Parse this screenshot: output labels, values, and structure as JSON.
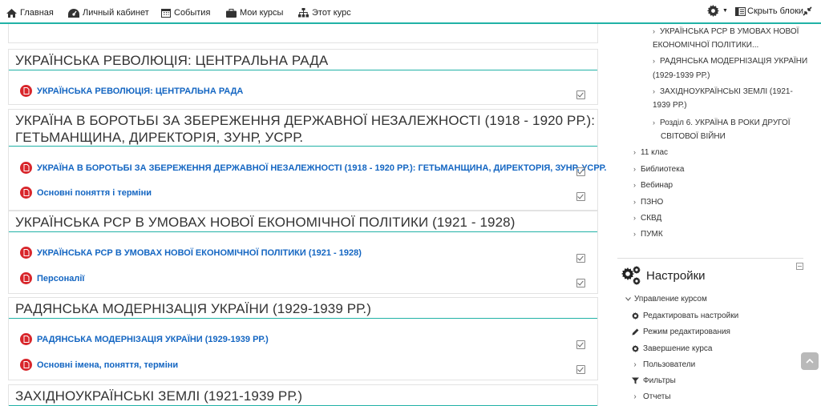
{
  "navbar": {
    "items": [
      {
        "label": "Главная",
        "icon": "home-icon"
      },
      {
        "label": "Личный кабинет",
        "icon": "dashboard-icon"
      },
      {
        "label": "События",
        "icon": "calendar-icon"
      },
      {
        "label": "Мои курсы",
        "icon": "briefcase-icon"
      },
      {
        "label": "Этот курс",
        "icon": "sitemap-icon"
      }
    ],
    "hide_blocks_label": "Скрыть блоки",
    "accent": "#21b2a6"
  },
  "sections": [
    {
      "title": "УКРАЇНСЬКА РЕВОЛЮЦІЯ: ЦЕНТРАЛЬНА РАДА",
      "activities": [
        "УКРАЇНСЬКА РЕВОЛЮЦІЯ: ЦЕНТРАЛЬНА РАДА"
      ]
    },
    {
      "title_line1": "УКРАЇНА В БОРОТЬБІ ЗА ЗБЕРЕЖЕННЯ ДЕРЖАВНОЇ НЕЗАЛЕЖНОСТІ (1918 - 1920 РР.):",
      "title_line2": "ГЕТЬМАНЩИНА, ДИРЕКТОРІЯ, ЗУНР, УСРР.",
      "activities": [
        "УКРАЇНА В БОРОТЬБІ ЗА ЗБЕРЕЖЕННЯ ДЕРЖАВНОЇ НЕЗАЛЕЖНОСТІ (1918 - 1920 РР.): ГЕТЬМАНЩИНА, ДИРЕКТОРІЯ, ЗУНР, УСРР.",
        "Основні поняття і терміни"
      ]
    },
    {
      "title": "УКРАЇНСЬКА РСР В УМОВАХ НОВОЇ ЕКОНОМІЧНОЇ ПОЛІТИКИ (1921 - 1928)",
      "activities": [
        "УКРАЇНСЬКА РСР В УМОВАХ НОВОЇ ЕКОНОМІЧНОЇ ПОЛІТИКИ (1921 - 1928)",
        "Персоналії"
      ]
    },
    {
      "title": "РАДЯНСЬКА МОДЕРНІЗАЦІЯ УКРАЇНИ (1929-1939 РР.)",
      "activities": [
        "РАДЯНСЬКА МОДЕРНІЗАЦІЯ УКРАЇНИ (1929-1939 РР.)",
        "Основні імена, поняття, терміни"
      ]
    },
    {
      "title": "ЗАХІДНОУКРАЇНСЬКІ ЗЕМЛІ (1921-1939 РР.)",
      "activities": []
    }
  ],
  "nav_tree": {
    "items": [
      {
        "line1": "УКРАЇНСЬКА РСР В УМОВАХ НОВОЇ",
        "line2": "ЕКОНОМІЧНОЇ ПОЛІТИКИ..."
      },
      {
        "line1": "РАДЯНСЬКА МОДЕРНІЗАЦІЯ УКРАЇНИ",
        "line2": "(1929-1939 РР.)"
      },
      {
        "line1": "ЗАХІДНОУКРАЇНСЬКІ ЗЕМЛІ (1921-",
        "line2": "1939 РР.)"
      },
      {
        "line1": "Розділ 6. УКРАЇНА В РОКИ ДРУГОЇ",
        "line2": "СВІТОВОЇ ВІЙНИ"
      }
    ],
    "top_items": [
      "11 клас",
      "Библиотека",
      "Вебинар",
      "ПЗНО",
      "СКВД",
      "ПУМК"
    ]
  },
  "settings": {
    "title": "Настройки",
    "course_admin": "Управление курсом",
    "items": [
      {
        "label": "Редактировать настройки",
        "icon": "gear-icon"
      },
      {
        "label": "Режим редактирования",
        "icon": "pencil-icon"
      },
      {
        "label": "Завершение курса",
        "icon": "gear-icon"
      },
      {
        "label": "Пользователи",
        "icon": "chevron-right-icon"
      },
      {
        "label": "Фильтры",
        "icon": "filter-icon"
      },
      {
        "label": "Отчеты",
        "icon": "chevron-right-icon"
      }
    ]
  }
}
